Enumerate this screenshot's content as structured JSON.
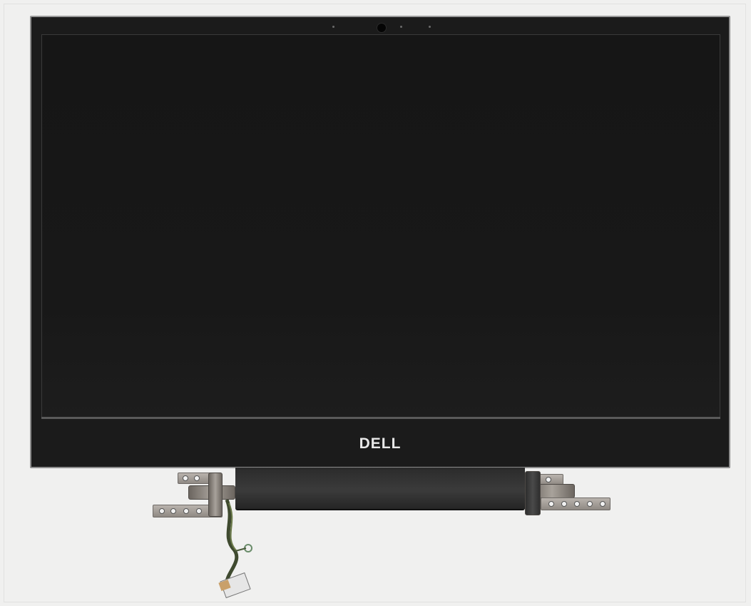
{
  "logo": {
    "text": "DELL"
  }
}
